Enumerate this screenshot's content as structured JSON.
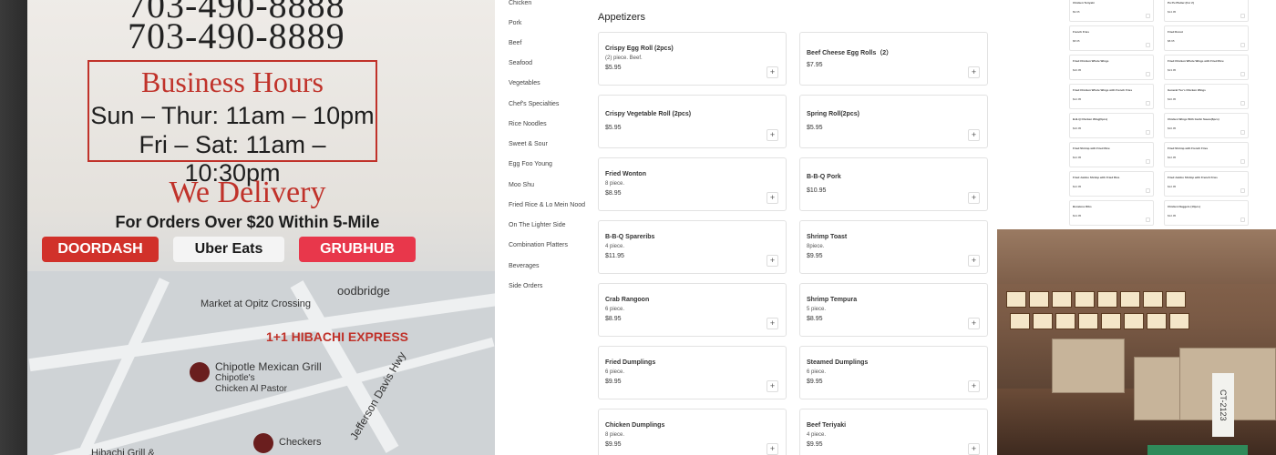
{
  "flyer": {
    "phone_1": "703-490-8888",
    "phone_2": "703-490-8889",
    "hours_title": "Business Hours",
    "hours_line_1": "Sun – Thur: 11am – 10pm",
    "hours_line_2": "Fri – Sat: 11am – 10:30pm",
    "delivery_title": "We Delivery",
    "delivery_sub": "For Orders Over $20 Within 5-Mile",
    "services": [
      {
        "label": "DOORDASH",
        "color": "#d1312a"
      },
      {
        "label": "Uber Eats",
        "color": "#1a1a1a"
      },
      {
        "label": "GRUBHUB",
        "color": "#e8374b"
      }
    ],
    "map_labels": {
      "market": "Market at Opitz Crossing",
      "restaurant": "1+1 HIBACHI EXPRESS",
      "area": "oodbridge",
      "chipotle": "Chipotle Mexican Grill",
      "chipotle_sub": "Chipotle's",
      "chipotle_sub2": "Chicken Al Pastor",
      "street": "Jefferson Davis Hwy",
      "checkers": "Checkers",
      "hibachi_grill": "Hibachi Grill &"
    }
  },
  "sidebar": {
    "items": [
      "Chicken",
      "Pork",
      "Beef",
      "Seafood",
      "Vegetables",
      "Chef's Specialties",
      "Rice Noodles",
      "Sweet & Sour",
      "Egg Foo Young",
      "Moo Shu",
      "Fried Rice & Lo Mein Nood",
      "On The Lighter Side",
      "Combination Platters",
      "Beverages",
      "Side Orders"
    ]
  },
  "menu": {
    "section_title": "Appetizers",
    "add_label": "+",
    "items": [
      {
        "name": "Crispy Egg Roll (2pcs)",
        "desc": "(2) piece. Beef.",
        "price": "$5.95"
      },
      {
        "name": "Beef Cheese Egg Rolls（2）",
        "desc": "",
        "price": "$7.95"
      },
      {
        "name": "Crispy Vegetable Roll (2pcs)",
        "desc": "",
        "price": "$5.95"
      },
      {
        "name": "Spring Roll(2pcs)",
        "desc": "",
        "price": "$5.95"
      },
      {
        "name": "Fried Wonton",
        "desc": "8 piece.",
        "price": "$8.95"
      },
      {
        "name": "B-B-Q Pork",
        "desc": "",
        "price": "$10.95"
      },
      {
        "name": "B-B-Q Spareribs",
        "desc": "4 piece.",
        "price": "$11.95"
      },
      {
        "name": "Shrimp Toast",
        "desc": "8piece.",
        "price": "$9.95"
      },
      {
        "name": "Crab Rangoon",
        "desc": "6 piece.",
        "price": "$8.95"
      },
      {
        "name": "Shrimp Tempura",
        "desc": "5 piece.",
        "price": "$8.95"
      },
      {
        "name": "Fried Dumplings",
        "desc": "6 piece.",
        "price": "$9.95"
      },
      {
        "name": "Steamed Dumplings",
        "desc": "6 piece.",
        "price": "$9.95"
      },
      {
        "name": "Chicken Dumplings",
        "desc": "8 piece.",
        "price": "$9.95"
      },
      {
        "name": "Beef Teriyaki",
        "desc": "4 piece.",
        "price": "$9.95"
      }
    ]
  },
  "mini_menu": {
    "items": [
      {
        "name": "Chicken Teriyaki",
        "price": "$9.95"
      },
      {
        "name": "Pu Pu Platter (For 2)",
        "price": "$14.95"
      },
      {
        "name": "French Fries",
        "price": "$8.95"
      },
      {
        "name": "Fried Donut",
        "price": "$8.95"
      },
      {
        "name": "Fried Chicken Whole Wings",
        "price": "$10.95"
      },
      {
        "name": "Fried Chicken Whole Wings with Fried Rice",
        "price": "$13.95"
      },
      {
        "name": "Fried Chicken Whole Wings with French Fries",
        "price": "$12.95"
      },
      {
        "name": "General Tso's Chicken Wings",
        "price": "$10.95"
      },
      {
        "name": "B-B-Q Chicken Wing(6pcs)",
        "price": "$10.95"
      },
      {
        "name": "Chicken Wings With Garlic Sauce(6pcs)",
        "price": "$10.95"
      },
      {
        "name": "Fried Shrimp with Fried Rice",
        "price": "$12.95"
      },
      {
        "name": "Fried Shrimp with French Fries",
        "price": "$12.95"
      },
      {
        "name": "Fried Jumbo Shrimp with Fried Rice",
        "price": "$12.95"
      },
      {
        "name": "Fried Jumbo Shrimp with French Fries",
        "price": "$12.95"
      },
      {
        "name": "Boneless Ribs",
        "price": "$14.95"
      },
      {
        "name": "Chicken Nuggets (10pcs)",
        "price": "$12.95"
      }
    ]
  },
  "interior": {
    "box_label": "CT-2123"
  }
}
